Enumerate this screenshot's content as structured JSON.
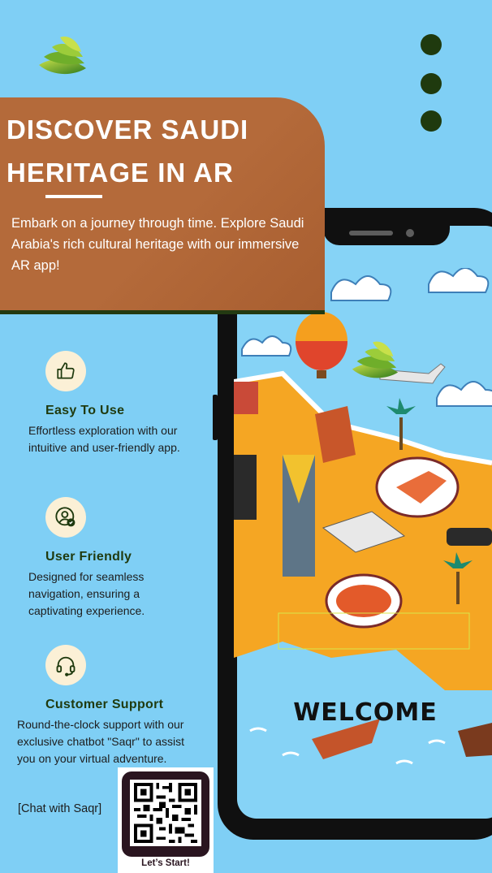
{
  "brand": {
    "logo_icon": "green-wing-logo",
    "colors": {
      "accent": "#b46a3a",
      "dark_green": "#1f3a0e",
      "background": "#7fcff5"
    }
  },
  "menu": {
    "icon": "kebab-menu-icon"
  },
  "hero": {
    "title_line1": "DISCOVER SAUDI",
    "title_line2": "HERITAGE IN AR",
    "description": "Embark on a journey through time. Explore Saudi Arabia's rich cultural heritage with our immersive AR app!"
  },
  "features": [
    {
      "icon": "thumbs-up-icon",
      "title": "Easy To Use",
      "line1": "Effortless exploration with our",
      "line2": "intuitive and user-friendly app.",
      "line3": ""
    },
    {
      "icon": "user-check-icon",
      "title": "User Friendly",
      "line1": "Designed for seamless",
      "line2": "navigation, ensuring a",
      "line3": "captivating experience."
    },
    {
      "icon": "headset-icon",
      "title": "Customer Support",
      "line1": "Round-the-clock support with our",
      "line2": "exclusive chatbot \"Saqr\" to assist",
      "line3": "you on your virtual adventure."
    }
  ],
  "chat": {
    "link_text": "[Chat with Saqr]"
  },
  "qr": {
    "label": "Let’s Start!"
  },
  "phone": {
    "welcome_text": "WELCOME"
  }
}
